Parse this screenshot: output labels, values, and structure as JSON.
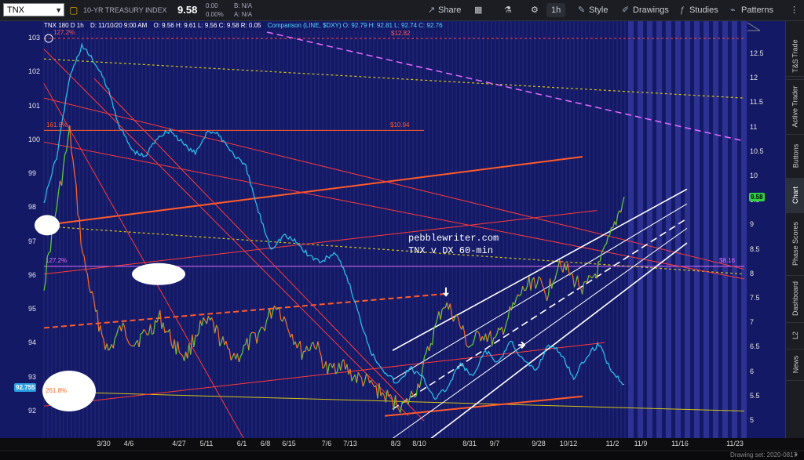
{
  "toolbar": {
    "symbol": "TNX",
    "description": "10-YR TREASURY INDEX",
    "last_price": "9.58",
    "change": "0.00",
    "change_pct": "0.00%",
    "bid": "B: N/A",
    "ask": "A: N/A",
    "share_label": "Share",
    "interval_label": "1h",
    "style_label": "Style",
    "drawings_label": "Drawings",
    "studies_label": "Studies",
    "patterns_label": "Patterns"
  },
  "chart_header": {
    "main": "TNX 180 D 1h",
    "date": "D: 11/10/20 9:00 AM",
    "ohlc": "O: 9.56  H: 9.61  L: 9.56  C: 9.58  R: 0.05",
    "comparison": "Comparison (LINE, $DXY)  O: 92.79  H: 92.81  L: 92.74  C: 92.76"
  },
  "watermark": {
    "line1": "pebblewriter.com",
    "line2": "TNX v DX 60-min"
  },
  "annotations": {
    "fib_top": "127.2%",
    "price_top": "$12.82",
    "fib_161": "161.8%",
    "price_1094": "$10.94",
    "fib_mid": "127.2%",
    "price_816": "$8.16",
    "fib_261": "261.8%"
  },
  "badges": {
    "right_price": "9.58",
    "left_price": "92.755"
  },
  "right_tabs": [
    "Trade",
    "T&S",
    "Active Trader",
    "Buttons",
    "Chart",
    "Phase Scores",
    "Dashboard",
    "L2",
    "News"
  ],
  "status": {
    "drawing_set": "Drawing set: 2020-0817"
  },
  "chart_data": {
    "type": "line",
    "left_axis": {
      "label": "$DXY",
      "ticks": [
        "103",
        "102",
        "101",
        "100",
        "99",
        "98",
        "97",
        "96",
        "95",
        "94",
        "93",
        "92"
      ],
      "ylim": [
        91.6,
        103.3
      ]
    },
    "right_axis": {
      "label": "TNX",
      "ticks": [
        "12.5",
        "12",
        "11.5",
        "11",
        "10.5",
        "10",
        "9.5",
        "9",
        "8.5",
        "8",
        "7.5",
        "7",
        "6.5",
        "6",
        "5.5",
        "5"
      ],
      "ylim": [
        4.85,
        13.2
      ]
    },
    "x_ticks": [
      "3/30",
      "4/6",
      "4/27",
      "5/11",
      "6/1",
      "6/8",
      "6/15",
      "7/6",
      "7/13",
      "8/3",
      "8/10",
      "8/31",
      "9/7",
      "9/28",
      "10/12",
      "11/2",
      "11/9",
      "11/16",
      "11/23"
    ],
    "series": [
      {
        "name": "$DXY",
        "color": "#2cc6ee",
        "values": [
          98.2,
          99.5,
          101.8,
          102.8,
          102.3,
          101.6,
          100.4,
          99.7,
          99.5,
          100.1,
          100.3,
          99.9,
          99.6,
          100.3,
          100.1,
          99.6,
          99.2,
          97.9,
          96.8,
          97.2,
          97.0,
          96.6,
          96.4,
          96.7,
          96.0,
          94.8,
          93.7,
          93.2,
          92.8,
          93.3,
          93.0,
          92.4,
          92.7,
          93.4,
          93.0,
          93.8,
          93.4,
          94.1,
          93.5,
          93.2,
          94.0,
          93.7,
          93.0,
          93.6,
          94.0,
          93.2,
          92.8
        ]
      },
      {
        "name": "TNX",
        "color": "#ff6a2b",
        "values": [
          7.8,
          9.4,
          10.9,
          8.4,
          7.2,
          6.4,
          6.9,
          6.6,
          6.8,
          7.1,
          6.6,
          6.3,
          6.9,
          7.0,
          6.5,
          6.3,
          6.6,
          6.9,
          7.4,
          6.9,
          6.4,
          6.6,
          6.0,
          6.2,
          5.9,
          5.8,
          5.6,
          5.4,
          5.3,
          5.7,
          6.6,
          7.4,
          7.1,
          6.5,
          6.8,
          6.6,
          7.1,
          7.6,
          7.9,
          7.6,
          8.3,
          7.9,
          7.7,
          8.1,
          8.8,
          9.58
        ]
      }
    ]
  }
}
